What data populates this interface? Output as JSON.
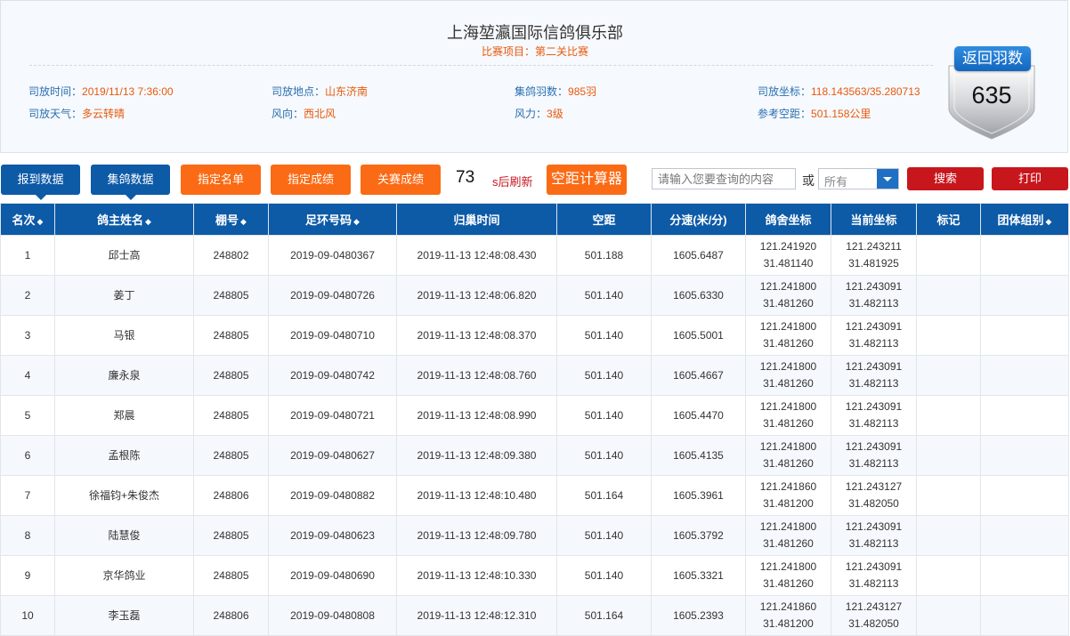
{
  "header": {
    "club_name": "上海堃瀛国际信鸽俱乐部",
    "race_label": "比赛项目：",
    "race_value": "第二关比赛",
    "info": [
      {
        "label": "司放时间：",
        "value": "2019/11/13 7:36:00"
      },
      {
        "label": "司放地点：",
        "value": "山东济南"
      },
      {
        "label": "集鸽羽数：",
        "value": "985羽"
      },
      {
        "label": "司放坐标：",
        "value": "118.143563/35.280713"
      },
      {
        "label": "司放天气：",
        "value": "多云转晴"
      },
      {
        "label": "风向：",
        "value": "西北风"
      },
      {
        "label": "风力：",
        "value": "3级"
      },
      {
        "label": "参考空距：",
        "value": "501.158公里"
      }
    ],
    "returned_label": "返回羽数",
    "returned_count": "635"
  },
  "toolbar": {
    "report_data": "报到数据",
    "collect_data": "集鸽数据",
    "named_list": "指定名单",
    "named_results": "指定成绩",
    "closed_results": "关赛成绩",
    "countdown": "73",
    "refresh_label": "s后刷新",
    "distance_calc": "空距计算器",
    "search_placeholder": "请输入您要查询的内容",
    "or_label": "或",
    "select_value": "所有",
    "search_button": "搜索",
    "print_button": "打印"
  },
  "table": {
    "columns": [
      {
        "label": "名次",
        "sortable": true
      },
      {
        "label": "鸽主姓名",
        "sortable": true
      },
      {
        "label": "棚号",
        "sortable": true
      },
      {
        "label": "足环号码",
        "sortable": true
      },
      {
        "label": "归巢时间",
        "sortable": false
      },
      {
        "label": "空距",
        "sortable": false
      },
      {
        "label": "分速(米/分)",
        "sortable": false
      },
      {
        "label": "鸽舍坐标",
        "sortable": false
      },
      {
        "label": "当前坐标",
        "sortable": false
      },
      {
        "label": "标记",
        "sortable": false
      },
      {
        "label": "团体组别",
        "sortable": true
      }
    ],
    "rows": [
      {
        "rank": "1",
        "owner": "邱士高",
        "loft": "248802",
        "ring": "2019-09-0480367",
        "time": "2019-11-13 12:48:08.430",
        "dist": "501.188",
        "speed": "1605.6487",
        "home1": "121.241920",
        "home2": "31.481140",
        "cur1": "121.243211",
        "cur2": "31.481925",
        "mark": "",
        "group": ""
      },
      {
        "rank": "2",
        "owner": "姜丁",
        "loft": "248805",
        "ring": "2019-09-0480726",
        "time": "2019-11-13 12:48:06.820",
        "dist": "501.140",
        "speed": "1605.6330",
        "home1": "121.241800",
        "home2": "31.481260",
        "cur1": "121.243091",
        "cur2": "31.482113",
        "mark": "",
        "group": ""
      },
      {
        "rank": "3",
        "owner": "马银",
        "loft": "248805",
        "ring": "2019-09-0480710",
        "time": "2019-11-13 12:48:08.370",
        "dist": "501.140",
        "speed": "1605.5001",
        "home1": "121.241800",
        "home2": "31.481260",
        "cur1": "121.243091",
        "cur2": "31.482113",
        "mark": "",
        "group": ""
      },
      {
        "rank": "4",
        "owner": "廉永泉",
        "loft": "248805",
        "ring": "2019-09-0480742",
        "time": "2019-11-13 12:48:08.760",
        "dist": "501.140",
        "speed": "1605.4667",
        "home1": "121.241800",
        "home2": "31.481260",
        "cur1": "121.243091",
        "cur2": "31.482113",
        "mark": "",
        "group": ""
      },
      {
        "rank": "5",
        "owner": "郑晨",
        "loft": "248805",
        "ring": "2019-09-0480721",
        "time": "2019-11-13 12:48:08.990",
        "dist": "501.140",
        "speed": "1605.4470",
        "home1": "121.241800",
        "home2": "31.481260",
        "cur1": "121.243091",
        "cur2": "31.482113",
        "mark": "",
        "group": ""
      },
      {
        "rank": "6",
        "owner": "孟根陈",
        "loft": "248805",
        "ring": "2019-09-0480627",
        "time": "2019-11-13 12:48:09.380",
        "dist": "501.140",
        "speed": "1605.4135",
        "home1": "121.241800",
        "home2": "31.481260",
        "cur1": "121.243091",
        "cur2": "31.482113",
        "mark": "",
        "group": ""
      },
      {
        "rank": "7",
        "owner": "徐福钧+朱俊杰",
        "loft": "248806",
        "ring": "2019-09-0480882",
        "time": "2019-11-13 12:48:10.480",
        "dist": "501.164",
        "speed": "1605.3961",
        "home1": "121.241860",
        "home2": "31.481200",
        "cur1": "121.243127",
        "cur2": "31.482050",
        "mark": "",
        "group": ""
      },
      {
        "rank": "8",
        "owner": "陆慧俊",
        "loft": "248805",
        "ring": "2019-09-0480623",
        "time": "2019-11-13 12:48:09.780",
        "dist": "501.140",
        "speed": "1605.3792",
        "home1": "121.241800",
        "home2": "31.481260",
        "cur1": "121.243091",
        "cur2": "31.482113",
        "mark": "",
        "group": ""
      },
      {
        "rank": "9",
        "owner": "京华鸽业",
        "loft": "248805",
        "ring": "2019-09-0480690",
        "time": "2019-11-13 12:48:10.330",
        "dist": "501.140",
        "speed": "1605.3321",
        "home1": "121.241800",
        "home2": "31.481260",
        "cur1": "121.243091",
        "cur2": "31.482113",
        "mark": "",
        "group": ""
      },
      {
        "rank": "10",
        "owner": "李玉磊",
        "loft": "248806",
        "ring": "2019-09-0480808",
        "time": "2019-11-13 12:48:12.310",
        "dist": "501.164",
        "speed": "1605.2393",
        "home1": "121.241860",
        "home2": "31.481200",
        "cur1": "121.243127",
        "cur2": "31.482050",
        "mark": "",
        "group": ""
      }
    ]
  }
}
